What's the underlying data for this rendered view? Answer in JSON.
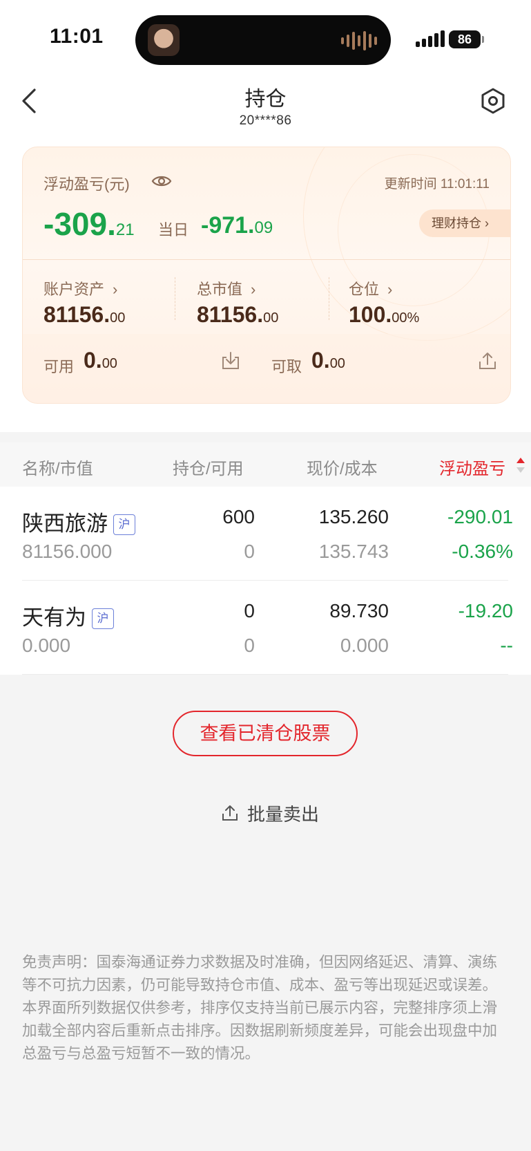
{
  "status_bar": {
    "time": "11:01",
    "battery": "86"
  },
  "header": {
    "title": "持仓",
    "account": "20****86"
  },
  "summary": {
    "pl_label": "浮动盈亏(元)",
    "update_time": "更新时间 11:01:11",
    "pl_int": "-309.",
    "pl_dec": "21",
    "today_label": "当日",
    "today_int": "-971.",
    "today_dec": "09",
    "wealth_label": "理财持仓 ›",
    "assets_label": "账户资产",
    "assets_int": "81156.",
    "assets_dec": "00",
    "mktval_label": "总市值",
    "mktval_int": "81156.",
    "mktval_dec": "00",
    "position_label": "仓位",
    "position_int": "100.",
    "position_dec": "00%",
    "available_label": "可用",
    "available_int": "0.",
    "available_dec": "00",
    "withdrawable_label": "可取",
    "withdrawable_int": "0.",
    "withdrawable_dec": "00",
    "chevron": "›"
  },
  "table": {
    "headers": [
      "名称/市值",
      "持仓/可用",
      "现价/成本",
      "浮动盈亏"
    ],
    "rows": [
      {
        "name": "陕西旅游",
        "market": "沪",
        "mv": "81156.000",
        "hold": "600",
        "avail": "0",
        "price": "135.260",
        "cost": "135.743",
        "pl": "-290.01",
        "pl_pct": "-0.36%"
      },
      {
        "name": "天有为",
        "market": "沪",
        "mv": "0.000",
        "hold": "0",
        "avail": "0",
        "price": "89.730",
        "cost": "0.000",
        "pl": "-19.20",
        "pl_pct": "--"
      }
    ]
  },
  "actions": {
    "cleared_label": "查看已清仓股票",
    "batch_sell_label": "批量卖出"
  },
  "disclaimer": "免责声明：国泰海通证券力求数据及时准确，但因网络延迟、清算、演练等不可抗力因素，仍可能导致持仓市值、成本、盈亏等出现延迟或误差。本界面所列数据仅供参考，排序仅支持当前已展示内容，完整排序须上滑加载全部内容后重新点击排序。因数据刷新频度差异，可能会出现盘中加总盈亏与总盈亏短暂不一致的情况。",
  "colors": {
    "loss_green": "#1aa34a",
    "accent_red": "#e3262c",
    "card_bg": "#fff3e8",
    "market_badge": "#5a6cd0"
  }
}
